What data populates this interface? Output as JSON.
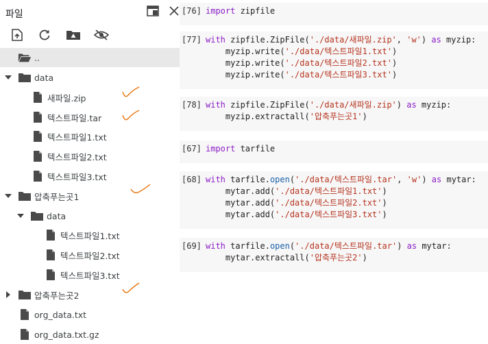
{
  "panel": {
    "title": "파일",
    "toolbar": [
      "upload-icon",
      "refresh-icon",
      "drive-icon",
      "hide-icon"
    ],
    "tree": [
      {
        "label": "..",
        "type": "folder-open",
        "depth": 0,
        "selected": true
      },
      {
        "label": "data",
        "type": "folder",
        "depth": 0,
        "expanded": true
      },
      {
        "label": "새파일.zip",
        "type": "file",
        "depth": 1
      },
      {
        "label": "텍스트파일.tar",
        "type": "file",
        "depth": 1
      },
      {
        "label": "텍스트파일1.txt",
        "type": "file",
        "depth": 1
      },
      {
        "label": "텍스트파일2.txt",
        "type": "file",
        "depth": 1
      },
      {
        "label": "텍스트파일3.txt",
        "type": "file",
        "depth": 1
      },
      {
        "label": "압축푸는곳1",
        "type": "folder",
        "depth": 0,
        "expanded": true
      },
      {
        "label": "data",
        "type": "folder",
        "depth": 1,
        "expanded": true
      },
      {
        "label": "텍스트파일1.txt",
        "type": "file",
        "depth": 2
      },
      {
        "label": "텍스트파일2.txt",
        "type": "file",
        "depth": 2
      },
      {
        "label": "텍스트파일3.txt",
        "type": "file",
        "depth": 2
      },
      {
        "label": "압축푸는곳2",
        "type": "folder",
        "depth": 0,
        "expanded": false
      },
      {
        "label": "org_data.txt",
        "type": "file",
        "depth": 0
      },
      {
        "label": "org_data.txt.gz",
        "type": "file",
        "depth": 0
      }
    ],
    "annotation_color": "#e8730c"
  },
  "cells": [
    {
      "prompt": "[76]",
      "lines": [
        [
          [
            "kw",
            "import"
          ],
          [
            "t",
            " zipfile"
          ]
        ]
      ]
    },
    {
      "prompt": "[77]",
      "lines": [
        [
          [
            "kw",
            "with"
          ],
          [
            "t",
            " zipfile.ZipFile("
          ],
          [
            "str",
            "'./data/새파일.zip'"
          ],
          [
            "t",
            ", "
          ],
          [
            "str",
            "'w'"
          ],
          [
            "t",
            ") "
          ],
          [
            "kw",
            "as"
          ],
          [
            "t",
            " myzip:"
          ]
        ],
        [
          [
            "t",
            "    myzip.write("
          ],
          [
            "str",
            "'./data/텍스트파일1.txt'"
          ],
          [
            "t",
            ")"
          ]
        ],
        [
          [
            "t",
            "    myzip.write("
          ],
          [
            "str",
            "'./data/텍스트파일2.txt'"
          ],
          [
            "t",
            ")"
          ]
        ],
        [
          [
            "t",
            "    myzip.write("
          ],
          [
            "str",
            "'./data/텍스트파일3.txt'"
          ],
          [
            "t",
            ")"
          ]
        ]
      ]
    },
    {
      "prompt": "[78]",
      "lines": [
        [
          [
            "kw",
            "with"
          ],
          [
            "t",
            " zipfile.ZipFile("
          ],
          [
            "str",
            "'./data/새파일.zip'"
          ],
          [
            "t",
            ") "
          ],
          [
            "kw",
            "as"
          ],
          [
            "t",
            " myzip:"
          ]
        ],
        [
          [
            "t",
            "    myzip.extractall("
          ],
          [
            "str",
            "'압축푸는곳1'"
          ],
          [
            "t",
            ")"
          ]
        ]
      ]
    },
    {
      "prompt": "[67]",
      "lines": [
        [
          [
            "kw",
            "import"
          ],
          [
            "t",
            " tarfile"
          ]
        ]
      ]
    },
    {
      "prompt": "[68]",
      "lines": [
        [
          [
            "kw",
            "with"
          ],
          [
            "t",
            " tarfile."
          ],
          [
            "fn",
            "open"
          ],
          [
            "t",
            "("
          ],
          [
            "str",
            "'./data/텍스트파일.tar'"
          ],
          [
            "t",
            ", "
          ],
          [
            "str",
            "'w'"
          ],
          [
            "t",
            ") "
          ],
          [
            "kw",
            "as"
          ],
          [
            "t",
            " mytar:"
          ]
        ],
        [
          [
            "t",
            "    mytar.add("
          ],
          [
            "str",
            "'./data/텍스트파일1.txt'"
          ],
          [
            "t",
            ")"
          ]
        ],
        [
          [
            "t",
            "    mytar.add("
          ],
          [
            "str",
            "'./data/텍스트파일2.txt'"
          ],
          [
            "t",
            ")"
          ]
        ],
        [
          [
            "t",
            "    mytar.add("
          ],
          [
            "str",
            "'./data/텍스트파일3.txt'"
          ],
          [
            "t",
            ")"
          ]
        ]
      ]
    },
    {
      "prompt": "[69]",
      "lines": [
        [
          [
            "kw",
            "with"
          ],
          [
            "t",
            " tarfile."
          ],
          [
            "fn",
            "open"
          ],
          [
            "t",
            "("
          ],
          [
            "str",
            "'./data/텍스트파일.tar'"
          ],
          [
            "t",
            ") "
          ],
          [
            "kw",
            "as"
          ],
          [
            "t",
            " mytar:"
          ]
        ],
        [
          [
            "t",
            "    mytar.extractall("
          ],
          [
            "str",
            "'압축푸는곳2'"
          ],
          [
            "t",
            ")"
          ]
        ]
      ]
    }
  ]
}
